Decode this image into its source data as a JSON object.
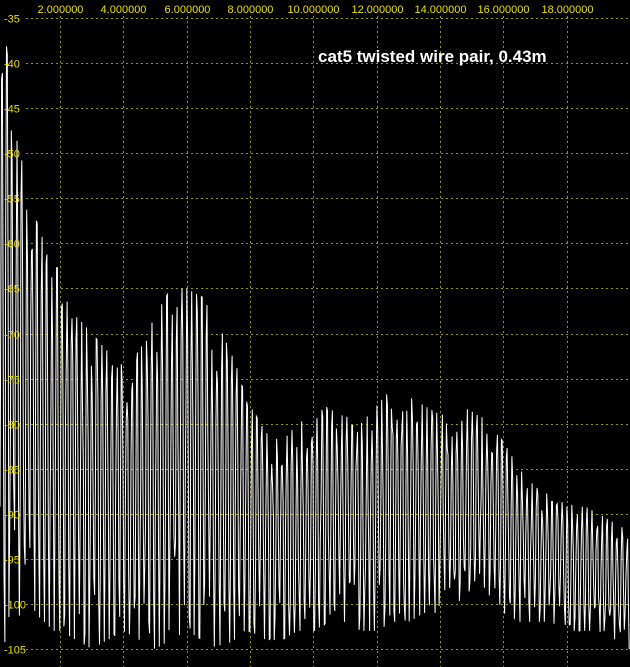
{
  "chart_data": {
    "type": "line",
    "title": "cat5 twisted wire pair, 0.43m",
    "xlabel": "",
    "ylabel": "",
    "xlim": [
      0.1,
      20.0
    ],
    "ylim": [
      -107,
      -33
    ],
    "x_ticks": [
      2,
      4,
      6,
      8,
      10,
      12,
      14,
      16,
      18
    ],
    "x_tick_labels": [
      "2.000000",
      "4.000000",
      "6.000000",
      "8.000000",
      "10.000000",
      "12.000000",
      "14.000000",
      "16.000000",
      "18.000000"
    ],
    "y_ticks": [
      -35,
      -40,
      -45,
      -50,
      -55,
      -60,
      -65,
      -70,
      -75,
      -80,
      -85,
      -90,
      -95,
      -100,
      -105
    ],
    "y_tick_labels": [
      "-35",
      "-40",
      "-45",
      "-50",
      "-55",
      "-60",
      "-65",
      "-70",
      "-75",
      "-80",
      "-85",
      "-90",
      "-95",
      "-100",
      "-105"
    ],
    "grid": true,
    "series": [
      {
        "envelope_x": [
          0.1,
          0.3,
          0.5,
          0.8,
          1.0,
          1.2,
          1.5,
          1.8,
          2.0,
          2.5,
          3.0,
          3.5,
          4.0,
          4.5,
          5.0,
          5.5,
          6.0,
          6.5,
          7.0,
          7.5,
          8.0,
          8.5,
          9.0,
          9.5,
          10.0,
          10.5,
          11.0,
          11.5,
          12.0,
          12.5,
          13.0,
          13.5,
          14.0,
          14.5,
          15.0,
          15.5,
          16.0,
          16.5,
          17.0,
          17.5,
          18.0,
          18.5,
          19.0,
          19.5,
          20.0
        ],
        "envelope_max": [
          -43,
          -38,
          -45,
          -51,
          -54,
          -57,
          -60,
          -61,
          -64,
          -68,
          -70,
          -72,
          -73,
          -72,
          -68,
          -65,
          -65,
          -66,
          -69,
          -73,
          -78,
          -81,
          -82,
          -80,
          -79,
          -78,
          -79,
          -80,
          -78,
          -76,
          -77,
          -78,
          -79,
          -79,
          -78,
          -80,
          -82,
          -85,
          -87,
          -88,
          -89,
          -89,
          -90,
          -91,
          -92
        ],
        "envelope_min": [
          -105,
          -104,
          -102,
          -101,
          -100,
          -101,
          -102,
          -103,
          -103,
          -104,
          -105,
          -104,
          -103,
          -104,
          -105,
          -104,
          -103,
          -104,
          -105,
          -104,
          -103,
          -104,
          -104,
          -103,
          -103,
          -102,
          -102,
          -103,
          -103,
          -102,
          -102,
          -101,
          -101,
          -101,
          -101,
          -101,
          -101,
          -102,
          -102,
          -102,
          -103,
          -103,
          -103,
          -104,
          -105
        ],
        "sweep_points": 780,
        "ripple_period": 0.158
      }
    ]
  }
}
